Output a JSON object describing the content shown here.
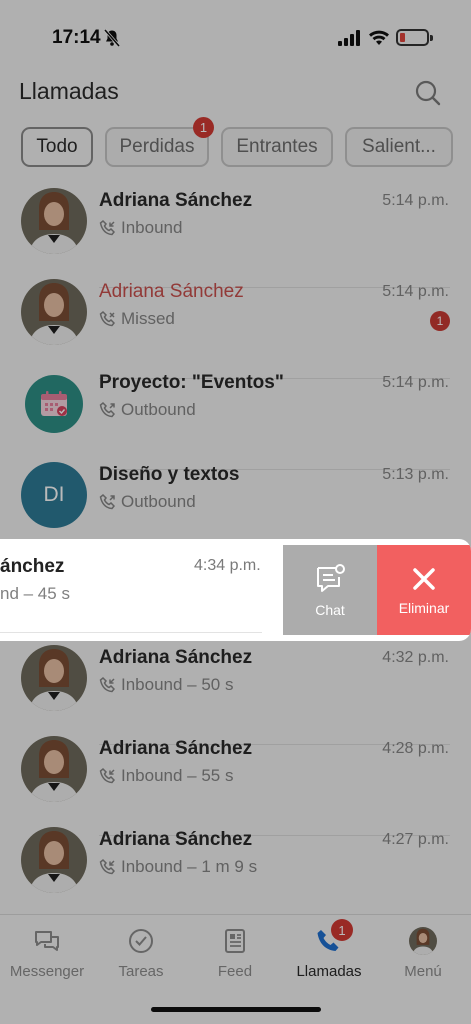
{
  "status_bar": {
    "time": "17:14"
  },
  "header": {
    "title": "Llamadas"
  },
  "filters": [
    {
      "label": "Todo",
      "active": true
    },
    {
      "label": "Perdidas",
      "badge": "1"
    },
    {
      "label": "Entrantes"
    },
    {
      "label": "Salient..."
    }
  ],
  "calls": [
    {
      "name": "Adriana Sánchez",
      "type": "Inbound",
      "time": "5:14 p.m."
    },
    {
      "name": "Adriana Sánchez",
      "type": "Missed",
      "time": "5:14 p.m.",
      "badge": "1"
    },
    {
      "name": "Proyecto: \"Eventos\"",
      "type": "Outbound",
      "time": "5:14 p.m."
    },
    {
      "name": "Diseño y textos",
      "initials": "DI",
      "type": "Outbound",
      "time": "5:13 p.m."
    },
    {
      "name": "ánchez",
      "type": "nd – 45 s",
      "time": "4:34 p.m."
    },
    {
      "name": "Adriana Sánchez",
      "type": "Inbound – 50 s",
      "time": "4:32 p.m."
    },
    {
      "name": "Adriana Sánchez",
      "type": "Inbound – 55 s",
      "time": "4:28 p.m."
    },
    {
      "name": "Adriana Sánchez",
      "type": "Inbound – 1 m 9 s",
      "time": "4:27 p.m."
    }
  ],
  "swipe_actions": {
    "chat_label": "Chat",
    "delete_label": "Eliminar"
  },
  "tabbar": [
    {
      "label": "Messenger",
      "icon": "chat-bubbles-icon"
    },
    {
      "label": "Tareas",
      "icon": "check-circle-icon"
    },
    {
      "label": "Feed",
      "icon": "newspaper-icon"
    },
    {
      "label": "Llamadas",
      "icon": "phone-icon",
      "badge": "1",
      "active": true
    },
    {
      "label": "Menú",
      "icon": "avatar"
    }
  ],
  "colors": {
    "missed": "#c9504d",
    "badge": "#d23a34",
    "delete": "#f26060",
    "chat_action": "#acacac",
    "active_phone": "#1f6fd0"
  }
}
